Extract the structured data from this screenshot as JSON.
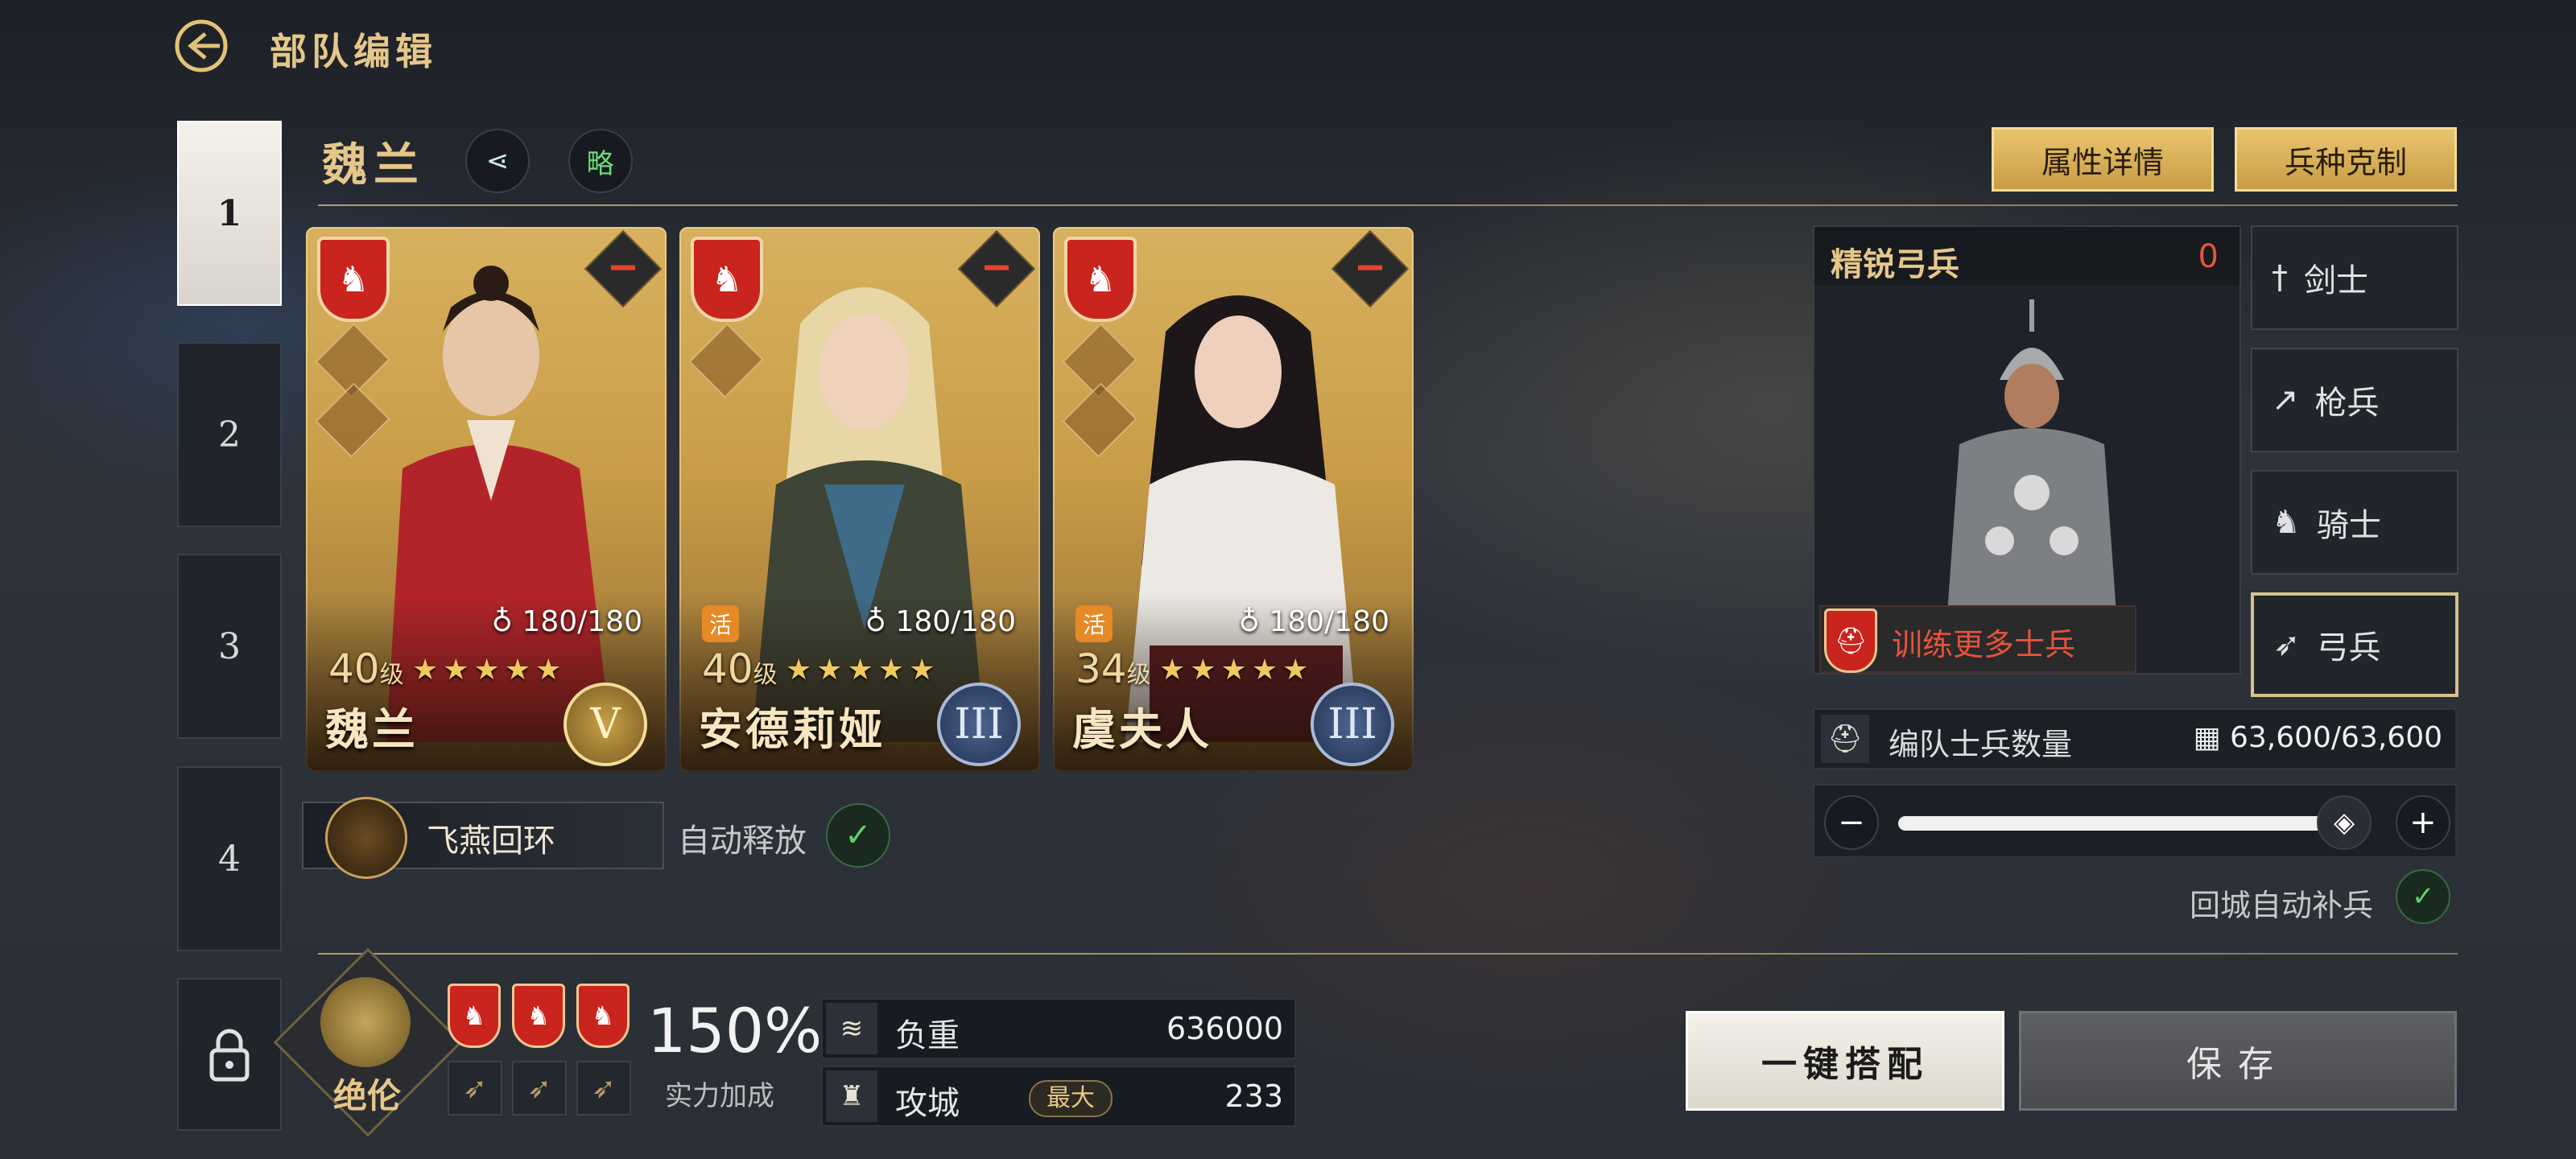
{
  "header": {
    "title": "部队编辑"
  },
  "tabs": [
    {
      "label": "1",
      "active": true
    },
    {
      "label": "2"
    },
    {
      "label": "3"
    },
    {
      "label": "4"
    },
    {
      "label": "lock-icon"
    }
  ],
  "team": {
    "name": "魏兰",
    "strategy_label": "略"
  },
  "top_buttons": {
    "attr_detail": "属性详情",
    "counter": "兵种克制"
  },
  "heroes": [
    {
      "name": "魏兰",
      "level": "40",
      "level_unit": "级",
      "stamina": "180/180",
      "stars": "★★★★★",
      "rank": "V",
      "active_tag": ""
    },
    {
      "name": "安德莉娅",
      "level": "40",
      "level_unit": "级",
      "stamina": "180/180",
      "stars": "★★★★★",
      "rank": "III",
      "active_tag": "活"
    },
    {
      "name": "虞夫人",
      "level": "34",
      "level_unit": "级",
      "stamina": "180/180",
      "stars": "★★★★★",
      "rank": "III",
      "active_tag": "活"
    }
  ],
  "skill": {
    "name": "飞燕回环",
    "auto_release": "自动释放"
  },
  "soldier": {
    "title": "精锐弓兵",
    "count": "0",
    "train_more": "训练更多士兵",
    "types": [
      "剑士",
      "枪兵",
      "骑士",
      "弓兵"
    ],
    "selected": "弓兵",
    "formation_label": "编队士兵数量",
    "formation_count": "63,600/63,600",
    "slider_fraction": 1.0,
    "auto_refill": "回城自动补兵"
  },
  "bottom": {
    "formation_name": "绝伦",
    "bonus_value": "150%",
    "bonus_label": "实力加成",
    "load_label": "负重",
    "load_value": "636000",
    "siege_label": "攻城",
    "siege_tag": "最大",
    "siege_value": "233"
  },
  "actions": {
    "auto_equip": "一键搭配",
    "save": "保存"
  },
  "colors": {
    "gold": "#e3c278",
    "red": "#c9241d",
    "green": "#5fd06c"
  }
}
